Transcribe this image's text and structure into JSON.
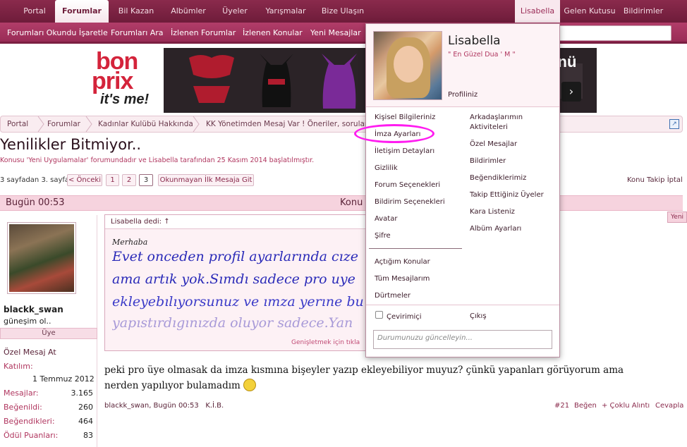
{
  "nav": {
    "tabs": [
      "Portal",
      "Forumlar",
      "Bil Kazan",
      "Albümler",
      "Üyeler",
      "Yarışmalar",
      "Bize Ulaşın"
    ],
    "user_tab": "Lisabella",
    "right_tabs": [
      "Gelen Kutusu",
      "Bildirimler"
    ]
  },
  "subnav": [
    "Forumları Okundu İşaretle",
    "Forumları Ara",
    "İzlenen Forumlar",
    "İzlenen Konular",
    "Yeni Mesajlar"
  ],
  "banner": {
    "logo_line1": "bon",
    "logo_line2": "prix",
    "logo_tagline": "it's me!",
    "title_fragment": "Günü",
    "cta_icon": "chevron-right-icon"
  },
  "breadcrumb": [
    "Portal",
    "Forumlar",
    "Kadınlar Kulübü Hakkında",
    "KK Yönetimden Mesaj Var ! Öneriler, sorular ?"
  ],
  "thread": {
    "title": "Yenilikler Bitmiyor..",
    "desc": "Konusu 'Yeni Uygulamalar' forumundadır ve Lisabella tarafından 25 Kasım 2014 başlatılmıştır.",
    "page_info": "3 sayfadan 3. sayfa",
    "prev": "< Önceki",
    "pages": [
      "1",
      "2",
      "3"
    ],
    "unread_jump": "Okunmayan İlk Mesaja Git",
    "follow_links": "Konu Takip İptal"
  },
  "post": {
    "date": "Bugün 00:53",
    "header_right": "Konu",
    "reply_tab": "Yeni",
    "quote_author": "Lisabella dedi: ↑",
    "quote_greet": "Merhaba",
    "quote_lines": [
      "Evet onceden profil ayarlarında cıze",
      "ama artık yok.Sımdı sadece pro uye",
      "ekleyebılıyorsunuz ve ımza yerıne bu",
      "yapıstırdıgınızda oluyor sadece.Yan"
    ],
    "quote_expand": "Genişletmek için tıkla",
    "body": "peki pro üye olmasak da imza kısmına bişeyler yazıp ekleyebiliyor muyuz? çünkü yapanları görüyorum ama nerden yapılıyor bulamadım",
    "foot_author": "blackk_swan, Bugün 00:53",
    "foot_report": "K.İ.B.",
    "post_number": "#21",
    "like": "Beğen",
    "multiquote": "+ Çoklu Alıntı",
    "reply": "Cevapla"
  },
  "user": {
    "name": "blackk_swan",
    "title": "güneşim ol..",
    "rank": "Üye",
    "pm": "Özel Mesaj At",
    "joined_label": "Katılım:",
    "joined": "1 Temmuz 2012",
    "stats": [
      {
        "k": "Mesajlar:",
        "v": "3.165"
      },
      {
        "k": "Beğenildi:",
        "v": "260"
      },
      {
        "k": "Beğendikleri:",
        "v": "464"
      },
      {
        "k": "Ödül Puanları:",
        "v": "83"
      }
    ]
  },
  "user_menu": {
    "name": "Lisabella",
    "status": "\" En Güzel Dua ' M \"",
    "profile": "Profiliniz",
    "left_items": [
      "Kişisel Bilgileriniz",
      "İmza Ayarları",
      "İletişim Detayları",
      "Gizlilik",
      "Forum Seçenekleri",
      "Bildirim Seçenekleri",
      "Avatar",
      "Şifre"
    ],
    "right_items": [
      "Arkadaşlarımın Aktiviteleri",
      "Özel Mesajlar",
      "Bildirimler",
      "Beğendiklerimiz",
      "Takip Ettiğiniz Üyeler",
      "Kara Listeniz",
      "Albüm Ayarları"
    ],
    "left_items_2": [
      "Açtığım Konular",
      "Tüm Mesajlarım",
      "Dürtmeler"
    ],
    "invisible": "Çevirimiçi",
    "logout": "Çıkış",
    "status_placeholder": "Durumunuzu güncelleyin..."
  },
  "colors": {
    "nav": "#7b2245",
    "subnav": "#a93563",
    "accent": "#b0365f",
    "highlight": "#ff1cf0"
  }
}
